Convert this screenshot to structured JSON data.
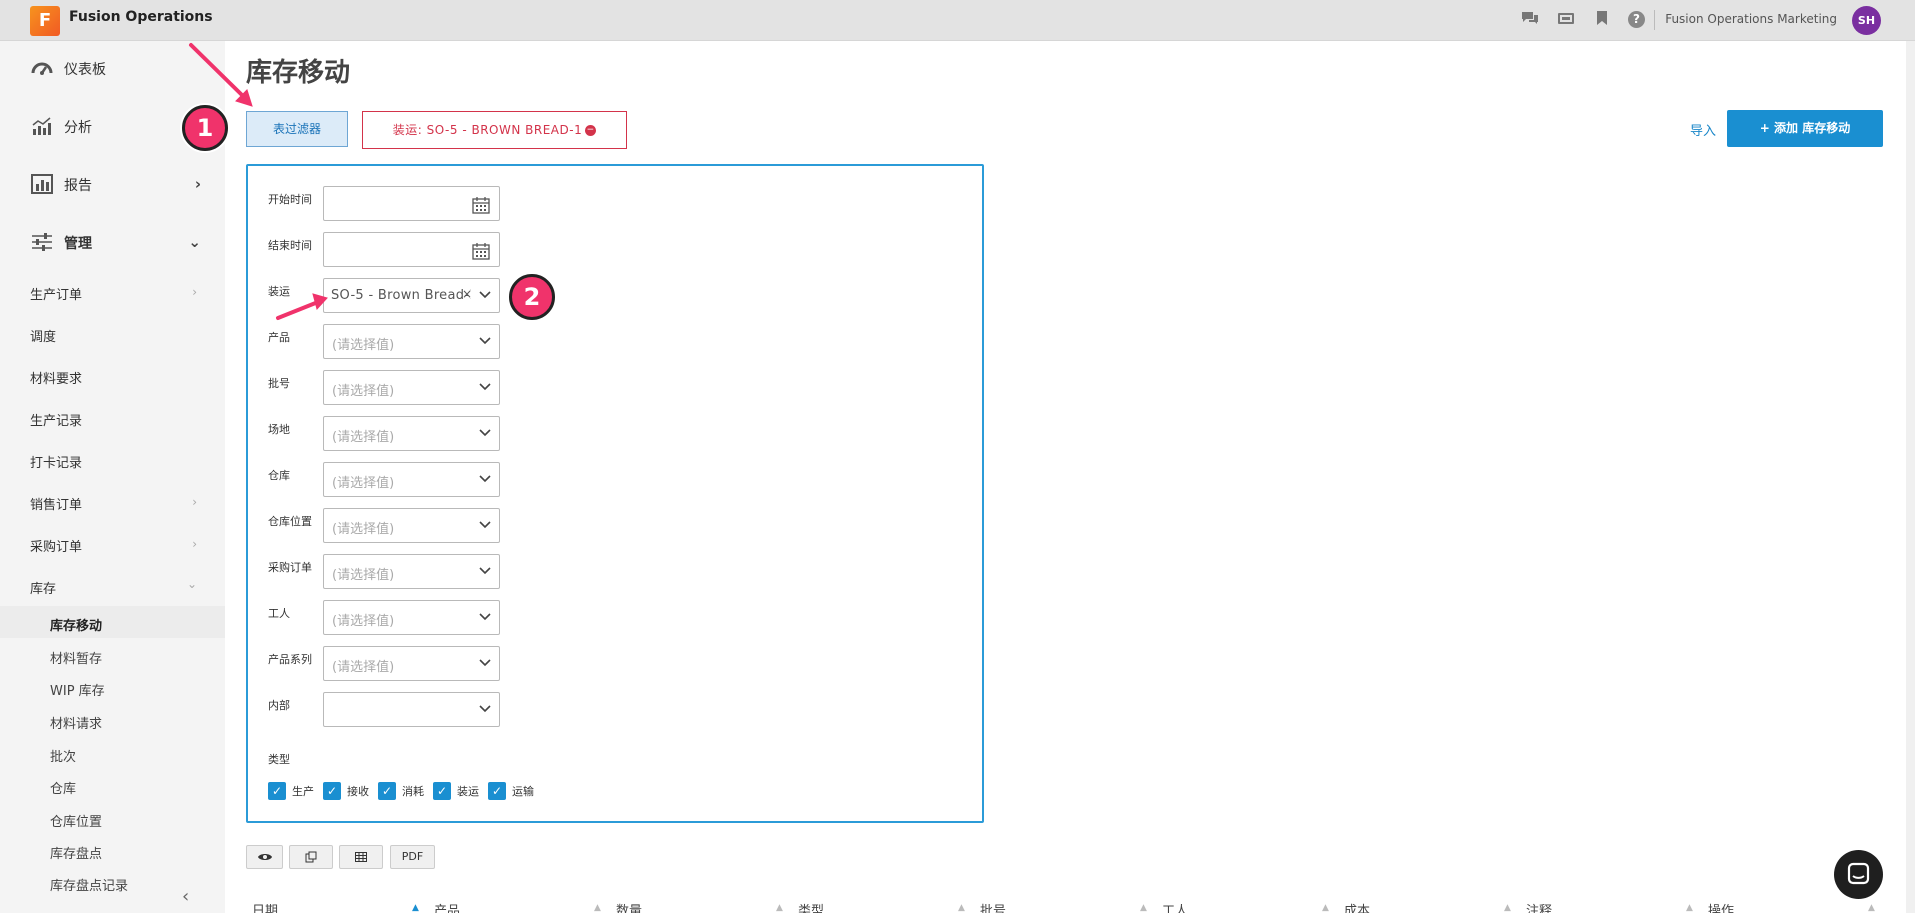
{
  "app": {
    "logo_letter": "F",
    "title": "Fusion Operations",
    "user_name": "Fusion Operations Marketing",
    "user_initials": "SH"
  },
  "top_icons": [
    "chat-icon",
    "video-icon",
    "bookmark-icon",
    "help-icon"
  ],
  "sidebar": {
    "main": [
      {
        "label": "仪表板",
        "icon": "dashboard-icon"
      },
      {
        "label": "分析",
        "icon": "analytics-icon"
      },
      {
        "label": "报告",
        "icon": "report-icon"
      },
      {
        "label": "管理",
        "icon": "sliders-icon"
      }
    ],
    "sub": [
      {
        "label": "生产订单",
        "has_arrow": true
      },
      {
        "label": "调度"
      },
      {
        "label": "材料要求"
      },
      {
        "label": "生产记录"
      },
      {
        "label": "打卡记录"
      },
      {
        "label": "销售订单",
        "has_arrow": true
      },
      {
        "label": "采购订单",
        "has_arrow": true
      },
      {
        "label": "库存",
        "expanded": true
      }
    ],
    "inventory": [
      {
        "label": "库存移动",
        "active": true
      },
      {
        "label": "材料暂存"
      },
      {
        "label": "WIP 库存"
      },
      {
        "label": "材料请求"
      },
      {
        "label": "批次"
      },
      {
        "label": "仓库"
      },
      {
        "label": "仓库位置"
      },
      {
        "label": "库存盘点"
      },
      {
        "label": "库存盘点记录"
      }
    ]
  },
  "page": {
    "title": "库存移动",
    "filter_button": "表过滤器",
    "active_filter_chip": "装运: SO-5 - BROWN BREAD-1",
    "import_link": "导入",
    "add_button": "+ 添加 库存移动"
  },
  "filters": {
    "start_time": {
      "label": "开始时间",
      "value": ""
    },
    "end_time": {
      "label": "结束时间",
      "value": ""
    },
    "shipment": {
      "label": "装运",
      "value": "SO-5 - Brown Bread-1"
    },
    "product": {
      "label": "产品",
      "placeholder": "(请选择值)"
    },
    "lot": {
      "label": "批号",
      "placeholder": "(请选择值)"
    },
    "site": {
      "label": "场地",
      "placeholder": "(请选择值)"
    },
    "warehouse": {
      "label": "仓库",
      "placeholder": "(请选择值)"
    },
    "warehouse_location": {
      "label": "仓库位置",
      "placeholder": "(请选择值)"
    },
    "purchase_order": {
      "label": "采购订单",
      "placeholder": "(请选择值)"
    },
    "worker": {
      "label": "工人",
      "placeholder": "(请选择值)"
    },
    "product_family": {
      "label": "产品系列",
      "placeholder": "(请选择值)"
    },
    "internal": {
      "label": "内部",
      "value": ""
    },
    "type_label": "类型",
    "types": [
      {
        "label": "生产",
        "checked": true
      },
      {
        "label": "接收",
        "checked": true
      },
      {
        "label": "消耗",
        "checked": true
      },
      {
        "label": "装运",
        "checked": true
      },
      {
        "label": "运输",
        "checked": true
      }
    ]
  },
  "toolbar": {
    "view_icon": "eye-icon",
    "copy_icon": "copy-icon",
    "table_icon": "table-icon",
    "pdf_label": "PDF"
  },
  "table": {
    "columns": [
      "日期",
      "产品",
      "数量",
      "类型",
      "批号",
      "工人",
      "成本",
      "注释",
      "操作"
    ]
  },
  "annotations": {
    "step1": "1",
    "step2": "2"
  },
  "colors": {
    "accent": "#1a8fd1",
    "chip_red": "#d3334a",
    "badge_pink": "#f0336b"
  }
}
